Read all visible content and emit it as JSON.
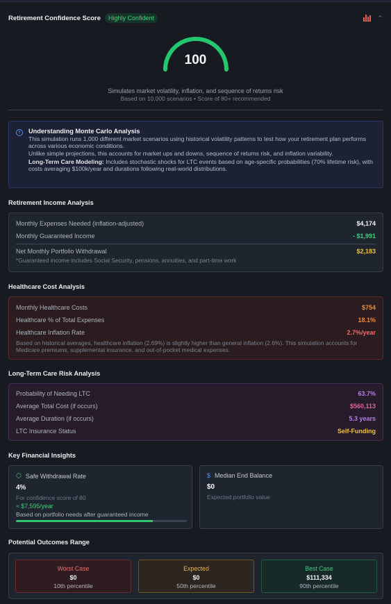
{
  "header": {
    "title": "Retirement Confidence Score",
    "badge": "Highly Confident",
    "chart_icon": "bar-chart-icon",
    "collapse_icon": "chevron-up-icon"
  },
  "gauge": {
    "value": "100",
    "fraction": 1.0,
    "color": "#22c76e",
    "description": "Simulates market volatility, inflation, and sequence of returns risk",
    "subtext": "Based on 10,000 scenarios • Score of 80+ recommended"
  },
  "info": {
    "icon": "info-icon",
    "title": "Understanding Monte Carlo Analysis",
    "p1": "This simulation runs 1,000 different market scenarios using historical volatility patterns to test how your retirement plan performs across various economic conditions.",
    "p2": "Unlike simple projections, this accounts for market ups and downs, sequence of returns risk, and inflation variability.",
    "p3_bold": "Long-Term Care Modeling:",
    "p3": " Includes stochastic shocks for LTC events based on age-specific probabilities (70% lifetime risk), with costs averaging $100k/year and durations following real-world distributions."
  },
  "income": {
    "title": "Retirement Income Analysis",
    "rows": [
      {
        "label": "Monthly Expenses Needed (inflation-adjusted)",
        "value": "$4,174",
        "color": "#f3f4f6"
      },
      {
        "label": "Monthly Guaranteed Income",
        "value": "- $1,991",
        "color": "#3fd07a"
      }
    ],
    "net": {
      "label": "Net Monthly Portfolio Withdrawal",
      "value": "$2,183",
      "color": "#f0c23a"
    },
    "note": "*Guaranteed income includes Social Security, pensions, annuities, and part-time work"
  },
  "healthcare": {
    "title": "Healthcare Cost Analysis",
    "rows": [
      {
        "label": "Monthly Healthcare Costs",
        "value": "$754",
        "color": "#f08a3a"
      },
      {
        "label": "Healthcare % of Total Expenses",
        "value": "18.1%",
        "color": "#f08a3a"
      },
      {
        "label": "Healthcare Inflation Rate",
        "value": "2.7%/year",
        "color": "#ef6b6b"
      }
    ],
    "note": "Based on historical averages, healthcare inflation (2.69%) is slightly higher than general inflation (2.6%). This simulation accounts for Medicare premiums, supplemental insurance, and out-of-pocket medical expenses."
  },
  "ltc": {
    "title": "Long-Term Care Risk Analysis",
    "rows": [
      {
        "label": "Probability of Needing LTC",
        "value": "63.7%",
        "color": "#b77ee6"
      },
      {
        "label": "Average Total Cost (if occurs)",
        "value": "$560,113",
        "color": "#e0609a"
      },
      {
        "label": "Average Duration (if occurs)",
        "value": "5.3 years",
        "color": "#b77ee6"
      },
      {
        "label": "LTC Insurance Status",
        "value": "Self-Funding",
        "color": "#f0c23a"
      }
    ]
  },
  "insights": {
    "title": "Key Financial Insights",
    "withdrawal": {
      "icon": "shield-icon",
      "label": "Safe Withdrawal Rate",
      "value": "4%",
      "sub": "For confidence score of 80",
      "monthly": "≈ $7,595/year",
      "based": "Based on portfolio needs after guaranteed income",
      "progress": 0.8
    },
    "balance": {
      "icon": "dollar-icon",
      "label": "Median End Balance",
      "value": "$0",
      "sub": "Expected portfolio value"
    }
  },
  "outcomes": {
    "title": "Potential Outcomes Range",
    "worst": {
      "label": "Worst Case",
      "value": "$0",
      "pct": "10th percentile"
    },
    "expected": {
      "label": "Expected",
      "value": "$0",
      "pct": "50th percentile"
    },
    "best": {
      "label": "Best Case",
      "value": "$111,334",
      "pct": "90th percentile"
    }
  }
}
